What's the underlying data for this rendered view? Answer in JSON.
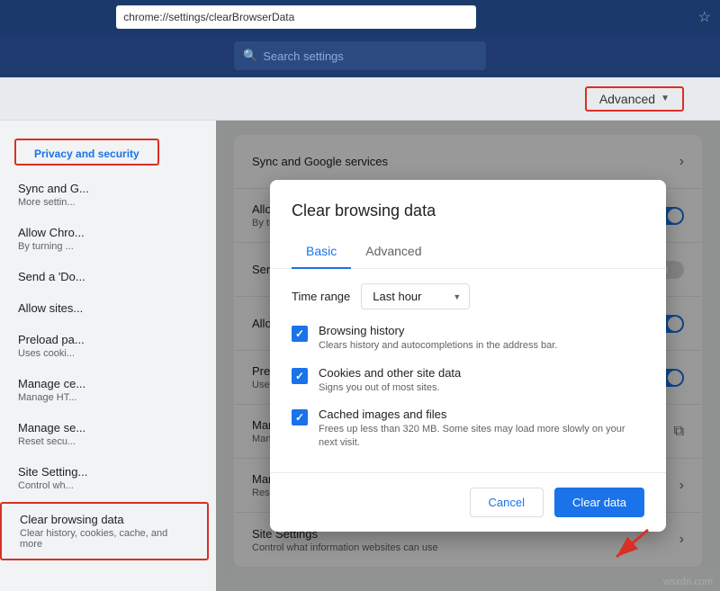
{
  "addressBar": {
    "url": "chrome://settings/clearBrowserData"
  },
  "searchBar": {
    "placeholder": "Search settings",
    "icon": "🔍"
  },
  "headerNav": {
    "advancedTab": "Advanced",
    "advancedArrow": "▼"
  },
  "sidebar": {
    "sectionTitle": "Privacy and security",
    "items": [
      {
        "title": "Sync and G...",
        "subtitle": "More settin..."
      },
      {
        "title": "Allow Chro...",
        "subtitle": "By turning ..."
      },
      {
        "title": "Send a 'Do...",
        "subtitle": ""
      },
      {
        "title": "Allow sites...",
        "subtitle": ""
      },
      {
        "title": "Preload pa...",
        "subtitle": "Uses cooki..."
      },
      {
        "title": "Manage ce...",
        "subtitle": "Manage HT..."
      },
      {
        "title": "Manage se...",
        "subtitle": "Reset secu..."
      },
      {
        "title": "Site Setting...",
        "subtitle": "Control wh..."
      },
      {
        "title": "Clear browsing data",
        "subtitle": "Clear history, cookies, cache, and more"
      }
    ]
  },
  "modal": {
    "title": "Clear browsing data",
    "tabs": [
      {
        "label": "Basic",
        "active": true
      },
      {
        "label": "Advanced",
        "active": false
      }
    ],
    "timeRange": {
      "label": "Time range",
      "value": "Last hour"
    },
    "checkboxes": [
      {
        "label": "Browsing history",
        "description": "Clears history and autocompletions in the address bar.",
        "checked": true
      },
      {
        "label": "Cookies and other site data",
        "description": "Signs you out of most sites.",
        "checked": true
      },
      {
        "label": "Cached images and files",
        "description": "Frees up less than 320 MB. Some sites may load more slowly on your next visit.",
        "checked": true
      }
    ],
    "buttons": {
      "cancel": "Cancel",
      "clearData": "Clear data"
    }
  },
  "watermark": "wsxdn.com"
}
